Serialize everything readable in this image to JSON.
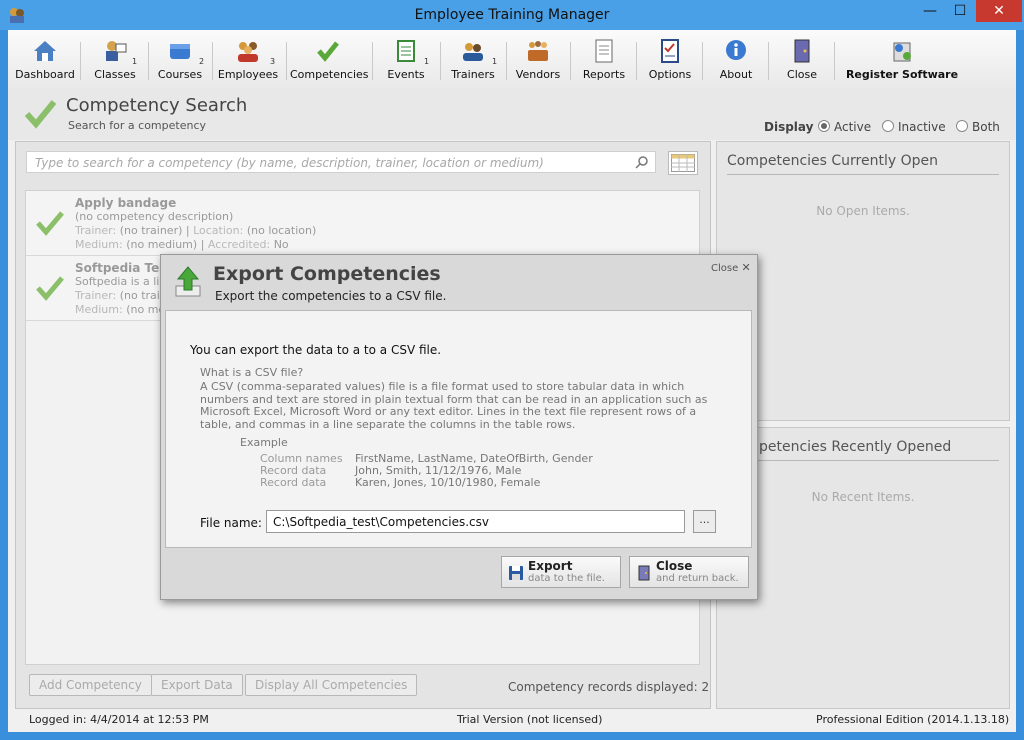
{
  "window": {
    "title": "Employee Training Manager",
    "minimize": "—",
    "maximize": "☐",
    "close": "✕"
  },
  "toolbar": [
    {
      "label": "Dashboard",
      "count": ""
    },
    {
      "label": "Classes",
      "count": "1"
    },
    {
      "label": "Courses",
      "count": "2"
    },
    {
      "label": "Employees",
      "count": "3"
    },
    {
      "label": "Competencies",
      "count": ""
    },
    {
      "label": "Events",
      "count": "1"
    },
    {
      "label": "Trainers",
      "count": "1"
    },
    {
      "label": "Vendors",
      "count": ""
    },
    {
      "label": "Reports",
      "count": ""
    },
    {
      "label": "Options",
      "count": ""
    },
    {
      "label": "About",
      "count": ""
    },
    {
      "label": "Close",
      "count": ""
    },
    {
      "label": "Register Software",
      "count": ""
    }
  ],
  "header": {
    "title": "Competency Search",
    "subtitle": "Search for a competency"
  },
  "display": {
    "label": "Display",
    "options": [
      "Active",
      "Inactive",
      "Both"
    ],
    "selected": "Active"
  },
  "search": {
    "placeholder": "Type to search for a competency (by name, description, trainer, location or medium)"
  },
  "competencies": [
    {
      "name": "Apply bandage",
      "description": "(no competency description)",
      "trainer_label": "Trainer:",
      "trainer": "(no trainer)",
      "location_label": "Location:",
      "location": "(no location)",
      "medium_label": "Medium:",
      "medium": "(no medium)",
      "accredited_label": "Accredited:",
      "accredited": "No"
    },
    {
      "name": "Softpedia Tes",
      "description": "Softpedia is a lib",
      "trainer_label": "Trainer:",
      "trainer": "(no trai",
      "medium_label": "Medium:",
      "medium": "(no me"
    }
  ],
  "bottom": {
    "add": "Add Competency",
    "export": "Export Data",
    "display_all": "Display All Competencies",
    "records": "Competency records displayed: 2"
  },
  "right": {
    "open_title": "Competencies Currently Open",
    "open_empty": "No Open Items.",
    "recent_title": "Competencies Recently Opened",
    "recent_empty": "No Recent Items."
  },
  "status": {
    "logged_in": "Logged in:  4/4/2014 at 12:53 PM",
    "license": "Trial Version (not licensed)",
    "edition": "Professional Edition (2014.1.13.18)"
  },
  "dialog": {
    "title": "Export Competencies",
    "subtitle": "Export the competencies to a CSV file.",
    "close": "Close",
    "intro": "You can export the data to a to a CSV file.",
    "what": "What is a CSV file?",
    "description": "A CSV (comma-separated values) file is a file format used to store tabular data in which numbers and text are stored in plain textual form that can be read in an application such as Microsoft Excel, Microsoft Word or any text editor. Lines in the text file represent rows of a table, and commas in a line separate the columns in the table rows.",
    "example_label": "Example",
    "example": [
      {
        "k": "Column names",
        "v": "FirstName, LastName, DateOfBirth, Gender"
      },
      {
        "k": "Record data",
        "v": "John, Smith, 11/12/1976, Male"
      },
      {
        "k": "Record data",
        "v": "Karen, Jones, 10/10/1980, Female"
      }
    ],
    "file_label": "File name:",
    "file_value": "C:\\Softpedia_test\\Competencies.csv",
    "browse": "...",
    "export_btn": {
      "title": "Export",
      "sub": "data to the file."
    },
    "close_btn": {
      "title": "Close",
      "sub": "and return back."
    }
  }
}
